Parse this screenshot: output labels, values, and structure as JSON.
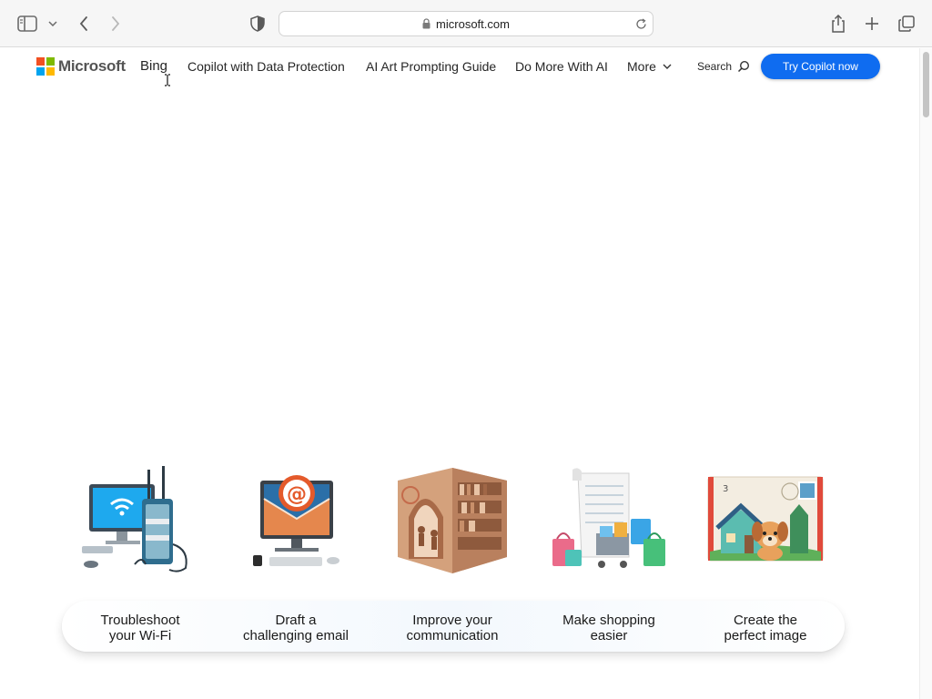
{
  "browser": {
    "url": "microsoft.com",
    "icons": [
      "sidebar-icon",
      "chevron-down-icon",
      "back-icon",
      "forward-icon",
      "privacy-shield-icon",
      "lock-icon",
      "reload-icon",
      "share-icon",
      "new-tab-icon",
      "tabs-overview-icon"
    ]
  },
  "nav": {
    "logo_text": "Microsoft",
    "logo_colors": [
      "#f25022",
      "#7fba00",
      "#00a4ef",
      "#ffb900"
    ],
    "links": [
      "Bing",
      "Copilot with Data Protection",
      "AI Art Prompting Guide",
      "Do More With AI"
    ],
    "more_label": "More",
    "search_label": "Search",
    "cta_label": "Try Copilot now",
    "cta_color": "#0f6cf0"
  },
  "cards": [
    {
      "line1": "Troubleshoot",
      "line2": "your Wi-Fi",
      "icon": "wifi-troubleshoot-illustration"
    },
    {
      "line1": "Draft a",
      "line2": "challenging email",
      "icon": "email-illustration"
    },
    {
      "line1": "Improve your",
      "line2": "communication",
      "icon": "bookshelf-illustration"
    },
    {
      "line1": "Make shopping",
      "line2": "easier",
      "icon": "shopping-illustration"
    },
    {
      "line1": "Create the",
      "line2": "perfect image",
      "icon": "postcard-illustration"
    }
  ]
}
